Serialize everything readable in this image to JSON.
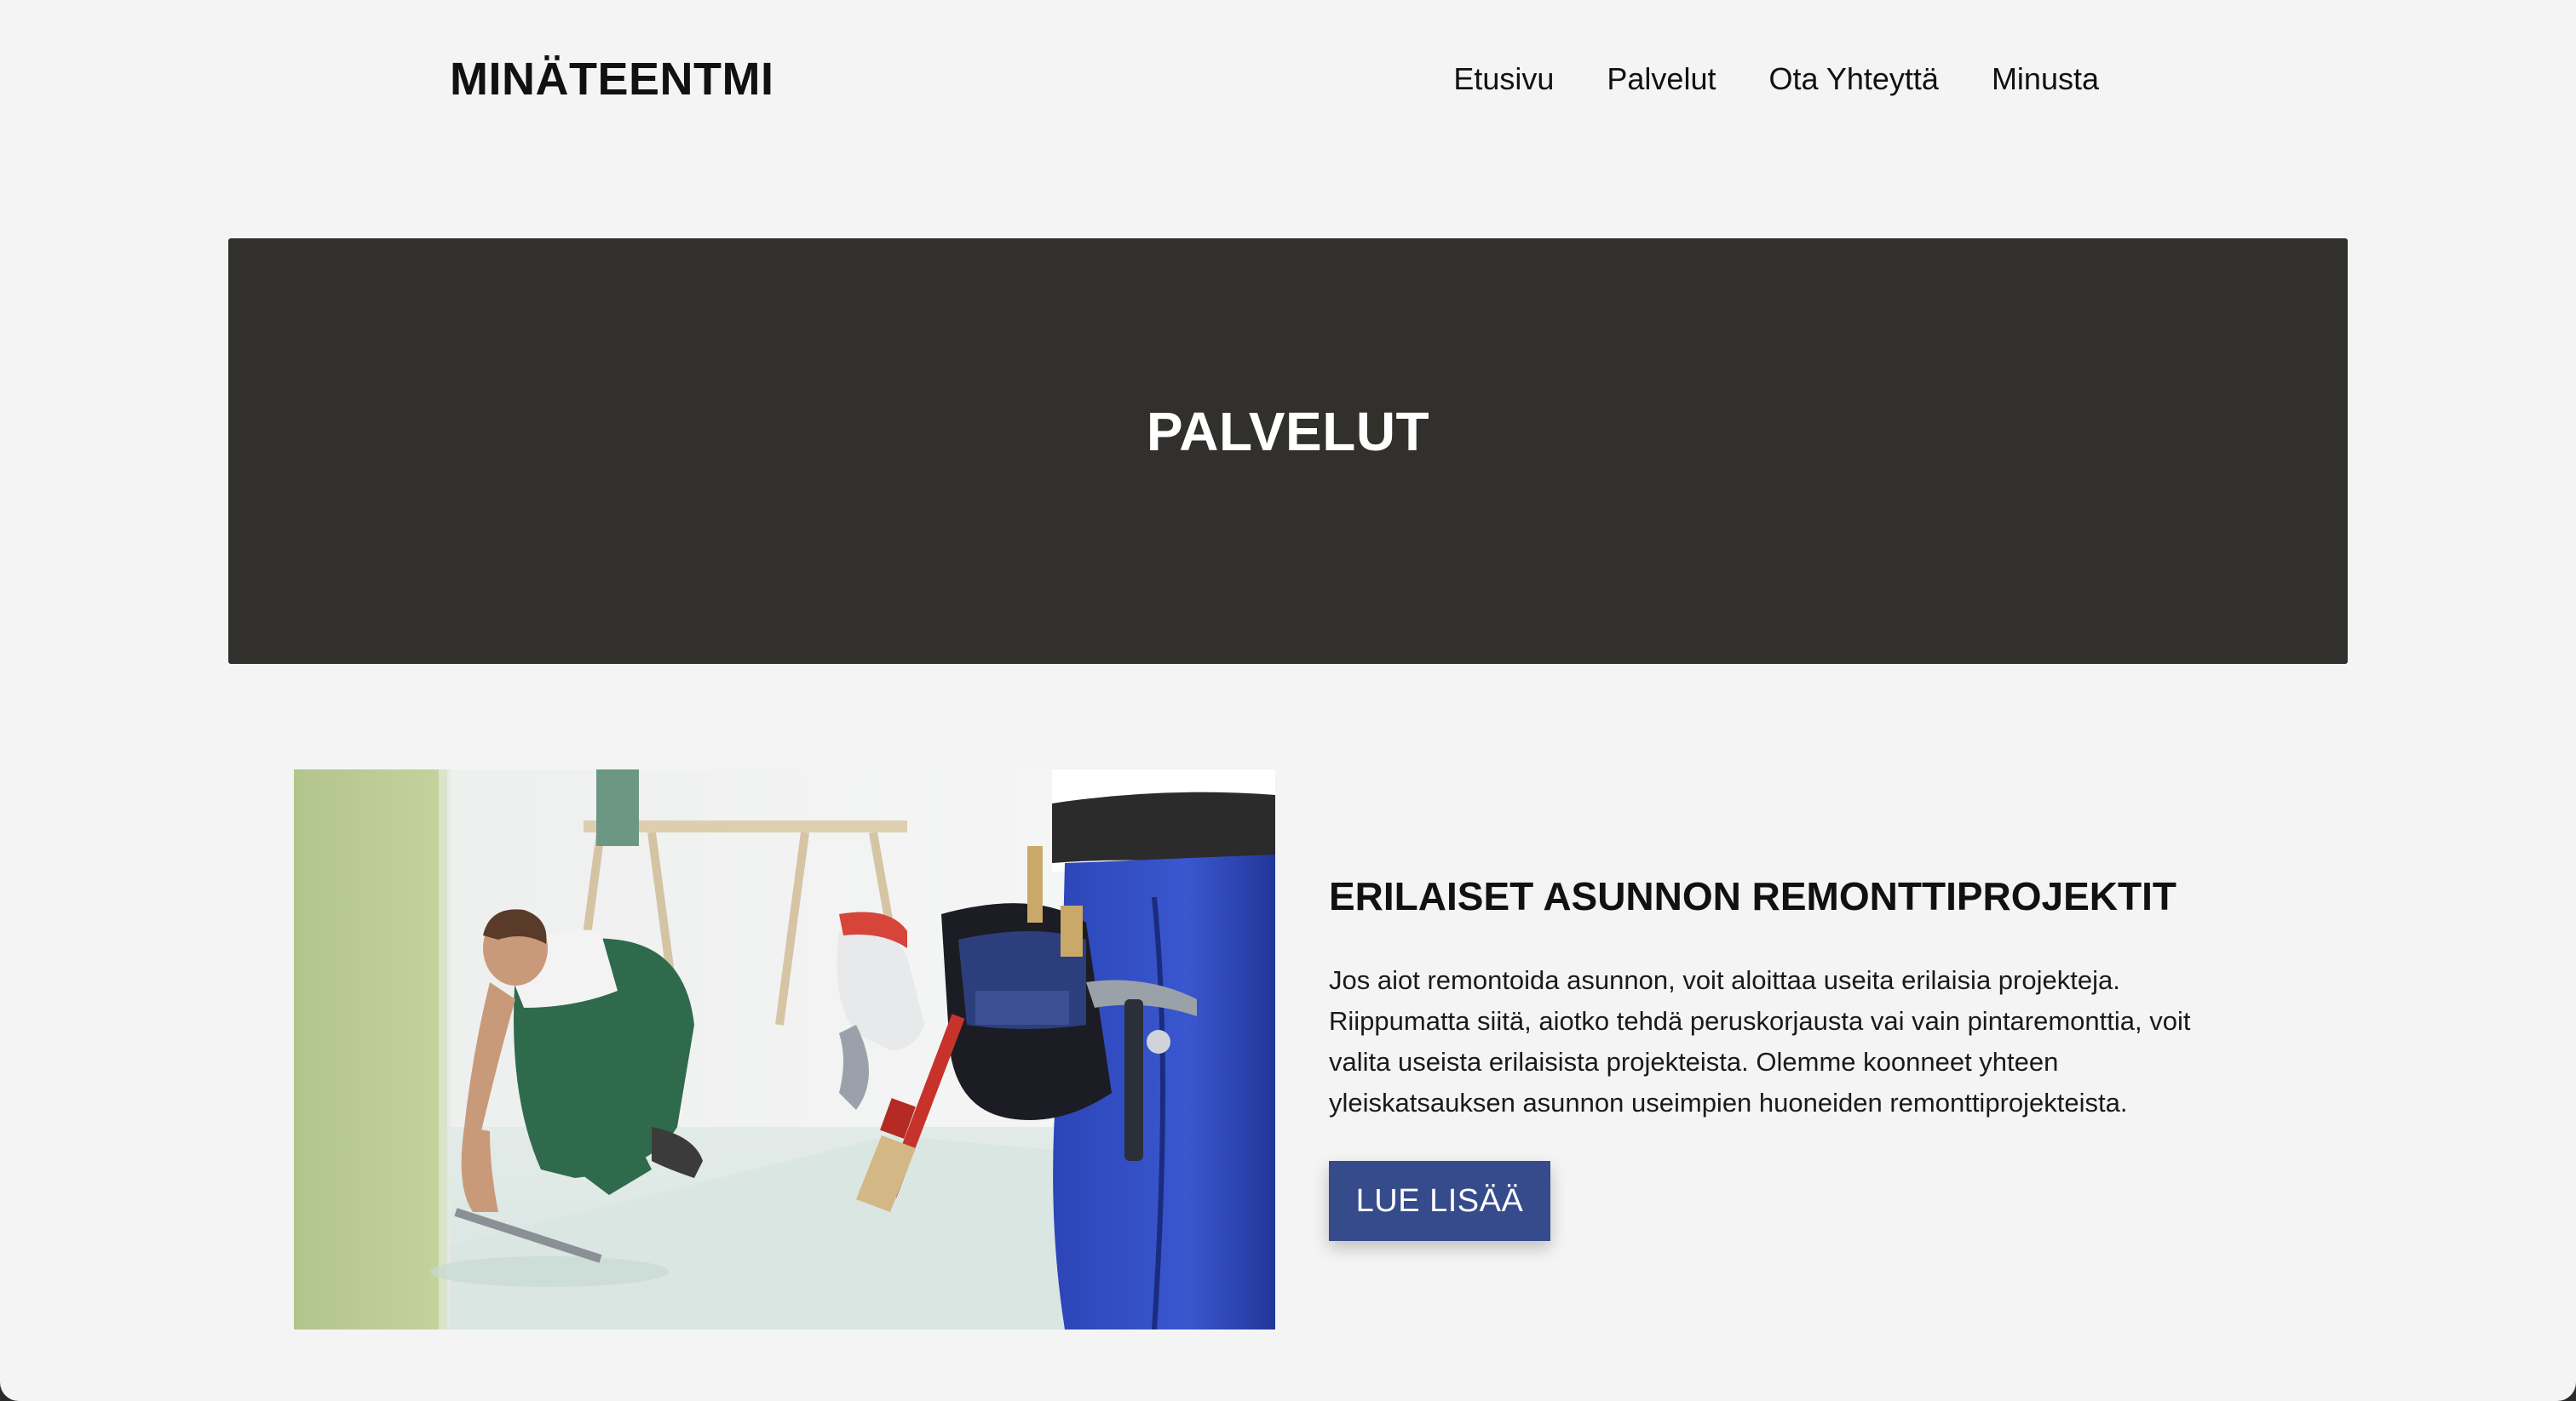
{
  "header": {
    "logo": "MINÄTEENTMI",
    "nav": [
      {
        "label": "Etusivu"
      },
      {
        "label": "Palvelut"
      },
      {
        "label": "Ota Yhteyttä"
      },
      {
        "label": "Minusta"
      }
    ]
  },
  "hero": {
    "title": "PALVELUT"
  },
  "service": {
    "title": "ERILAISET ASUNNON REMONTTIPROJEKTIT",
    "text": "Jos aiot remontoida asunnon, voit aloittaa useita erilaisia projekteja. Riippumatta siitä, aiotko tehdä peruskorjausta vai vain pintaremonttia, voit valita useista erilaisista projekteista. Olemme koonneet yhteen yleiskatsauksen asunnon useimpien huoneiden remonttiprojekteista.",
    "button_label": "LUE LISÄÄ",
    "image_icon": "renovation-worker-photo"
  },
  "colors": {
    "page_background": "#f4f4f4",
    "hero_background": "#32302c",
    "button_background": "#364b8b",
    "text": "#111111"
  }
}
